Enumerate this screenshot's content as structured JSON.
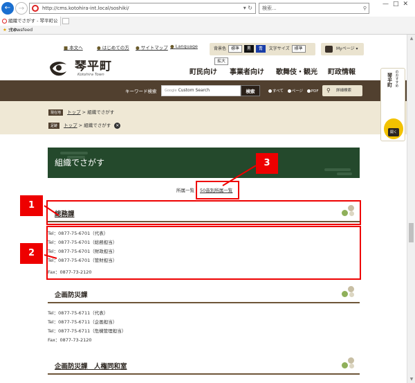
{
  "browser": {
    "url": "http://cms.kotohira-int.local/soshiki/",
    "search_placeholder": "検索...",
    "tab_title": "組織でさがす - 琴平町公式ホ...",
    "favorites_item": "newsfeed"
  },
  "site": {
    "util_links": {
      "main_text": "本文へ",
      "first_time": "はじめての方",
      "sitemap": "サイトマップ",
      "language": "Language"
    },
    "accessibility": {
      "bg_label": "背景色",
      "bg_standard": "標準",
      "bg_black": "黒",
      "bg_blue": "青",
      "font_label": "文字サイズ",
      "font_standard": "標準",
      "font_large": "拡大"
    },
    "mypage": "Myページ",
    "logo_name": "琴平町",
    "logo_sub": "Kotohira Town",
    "nav": {
      "residents": "町民向け",
      "business": "事業者向け",
      "kabuki_tourism": "歌舞伎・観光",
      "admin": "町政情報"
    },
    "search": {
      "label": "キーワード検索",
      "input_prefix": "Google",
      "input_value": "Custom Search",
      "button": "検索",
      "opt_all": "すべて",
      "opt_page": "ページ",
      "opt_pdf": "PDF",
      "advanced": "詳細検索"
    },
    "breadcrumb": {
      "current_tag": "現在地",
      "current_top": "トップ",
      "current_page": "組織でさがす",
      "history_tag": "足跡",
      "history_top": "トップ",
      "history_page": "組織でさがす"
    },
    "side_banner": {
      "title": "琴平町",
      "subtitle": "のおすすめ",
      "button": "開く"
    },
    "hero_title": "組織でさがす",
    "view_tabs": {
      "current": "所属一覧",
      "link": "50音別所属一覧"
    },
    "departments": [
      {
        "name": "総務課",
        "contacts": [
          "Tel：0877-75-6701（代表）",
          "Tel：0877-75-6701（総務担当）",
          "Tel：0877-75-6701（財政担当）",
          "Tel：0877-75-6701（管財担当）",
          "Fax：0877-73-2120"
        ]
      },
      {
        "name": "企画防災課",
        "contacts": [
          "Tel：0877-75-6711（代表）",
          "Tel：0877-75-6711（企画担当）",
          "Tel：0877-75-6711（危機管理担当）",
          "Fax：0877-73-2120"
        ]
      },
      {
        "name": "企画防災課　人権同和室",
        "contacts": []
      }
    ]
  },
  "annotations": {
    "badge_1": "1",
    "badge_2": "2",
    "badge_3": "3",
    "color": "#e00000"
  }
}
